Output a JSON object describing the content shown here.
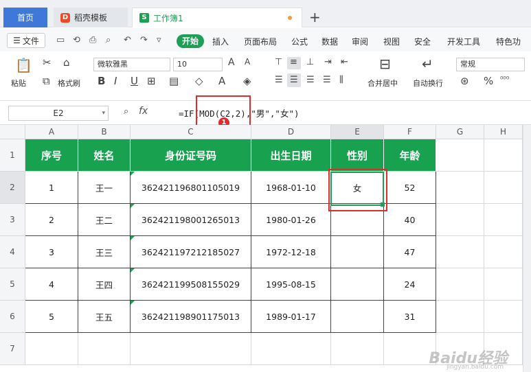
{
  "tabs": {
    "home": "首页",
    "template": "稻壳模板",
    "workbook": "工作簿1",
    "template_icon": "D",
    "workbook_icon": "S",
    "new_tab": "+"
  },
  "menu": {
    "file": "文件",
    "start": "开始",
    "items": [
      "插入",
      "页面布局",
      "公式",
      "数据",
      "审阅",
      "视图",
      "安全",
      "开发工具",
      "特色功"
    ]
  },
  "ribbon": {
    "paste": "粘贴",
    "format_painter": "格式刷",
    "font_name": "微软雅黑",
    "font_size": "10",
    "merge_center": "合并居中",
    "wrap_text": "自动换行",
    "number_format": "常规",
    "bold": "B",
    "italic": "I",
    "underline": "U",
    "font_grow": "A",
    "font_shrink": "A",
    "percent": "%"
  },
  "formula_bar": {
    "name_box": "E2",
    "fx": "fx",
    "formula": "=IF(MOD(C2,2),\"男\",\"女\")",
    "annotation_badge": "1"
  },
  "columns": [
    "A",
    "B",
    "C",
    "D",
    "E",
    "F",
    "G",
    "H"
  ],
  "rows": [
    "1",
    "2",
    "3",
    "4",
    "5",
    "6",
    "7"
  ],
  "table": {
    "headers": [
      "序号",
      "姓名",
      "身份证号码",
      "出生日期",
      "性别",
      "年龄"
    ],
    "rows": [
      [
        "1",
        "王一",
        "362421196801105019",
        "1968-01-10",
        "女",
        "52"
      ],
      [
        "2",
        "王二",
        "362421198001265013",
        "1980-01-26",
        "",
        "40"
      ],
      [
        "3",
        "王三",
        "362421197212185027",
        "1972-12-18",
        "",
        "47"
      ],
      [
        "4",
        "王四",
        "362421199508155029",
        "1995-08-15",
        "",
        "24"
      ],
      [
        "5",
        "王五",
        "362421198901175013",
        "1989-01-17",
        "",
        "31"
      ]
    ]
  },
  "watermark": {
    "brand": "Baidu经验",
    "url": "jingyan.baidu.com"
  },
  "colors": {
    "header_green": "#18a250",
    "accent_red": "#e12b2b",
    "tab_blue": "#3f78d8"
  }
}
